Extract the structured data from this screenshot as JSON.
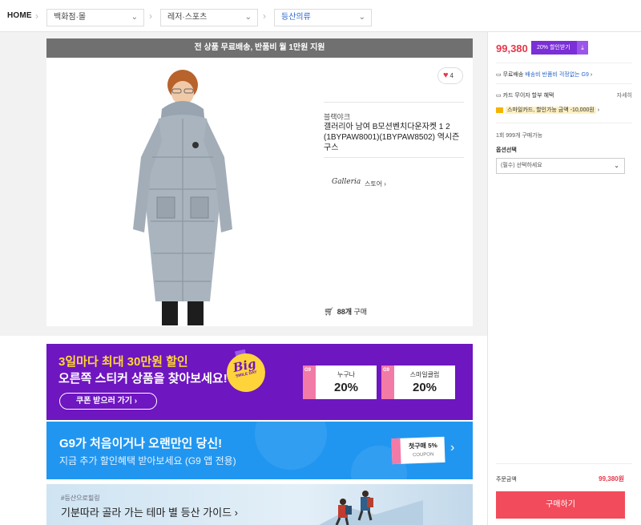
{
  "breadcrumb": {
    "home": "HOME",
    "cat1": "백화점·몰",
    "cat2": "레저·스포츠",
    "cat3": "등산의류"
  },
  "free_shipping_bar": "전 상품 무료배송, 반품비 월 1만원 지원",
  "product": {
    "likes": "4",
    "brand": "블랙야크",
    "title": "갤러리아 남여 B모션벤치다운자켓 1 2 (1BYPAW8001)(1BYPAW8502) 역시즌구스",
    "seller_logo": "Galleria",
    "store_link": "스토어 ›",
    "purchase_count": "88개",
    "purchase_suffix": "구매"
  },
  "banner_purple": {
    "line1": "3일마다 최대 30만원 할인",
    "line2": "오른쪽 스티커 상품을 찾아보세요!",
    "button": "쿠폰 받으러 가기 ›",
    "sticker_big": "Big",
    "sticker_sub": "SMILE DAY",
    "coupons": [
      {
        "stub": "G9",
        "label": "누구나",
        "value": "20%"
      },
      {
        "stub": "G9",
        "label": "스마일클럽",
        "value": "20%"
      }
    ]
  },
  "banner_blue": {
    "title": "G9가 처음이거나 오랜만인 당신!",
    "subtitle": "지금 추가 할인혜택 받아보세요 (G9 앱 전용)",
    "coupon_title": "첫구매 5%",
    "coupon_sub": "COUPON",
    "arrow": "›"
  },
  "banner_hike": {
    "tag": "#등산으로힐링",
    "title": "기분따라 골라 가는 테마 별 등산 가이드 ›"
  },
  "side": {
    "price": "99,380",
    "discount_btn": "20% 할인받기",
    "ship_prefix": "무료배송",
    "ship_blue": "배송비 반품비 걱정없는 G9",
    "ship_arrow": "›",
    "card": "카드 무이자 할부 혜택",
    "card_more": "자세히",
    "smile": "스마일카드, 할인가능 금액 -10,000원",
    "smile_arrow": "›",
    "limit": "1회 999개 구매가능",
    "option_label": "옵션선택",
    "option_placeholder": "(필수) 선택하세요",
    "total_label": "주문금액",
    "total_value": "99,380원",
    "buy": "구매하기"
  },
  "colors": {
    "accent_red": "#e8364b",
    "purple": "#6e16c0",
    "blue": "#2196f0",
    "buy_button": "#f24b5b"
  }
}
